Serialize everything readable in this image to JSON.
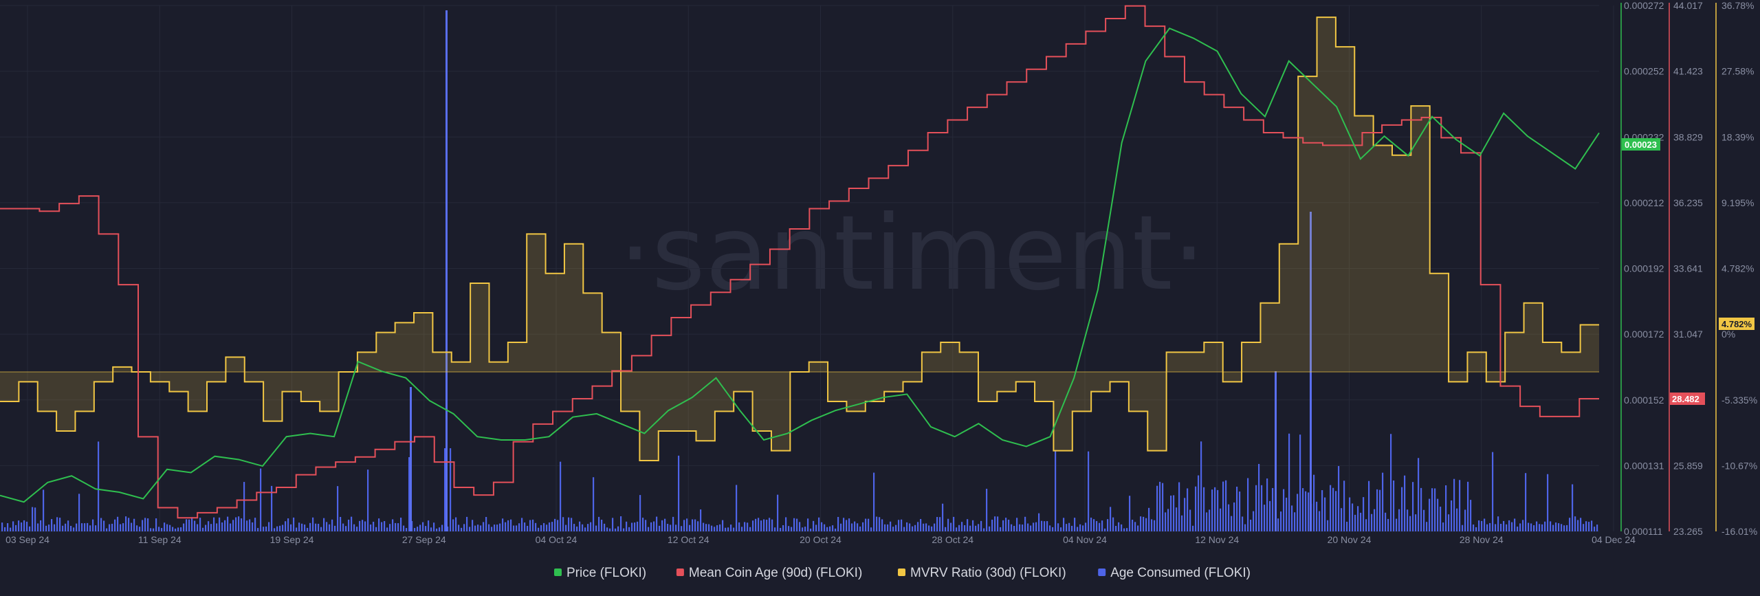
{
  "watermark": "·santiment·",
  "badges": {
    "price": "0.00023",
    "coin_age": "28.482",
    "mvrv": "4.782%"
  },
  "colors": {
    "background": "#1b1d2b",
    "price": "#2fbf4f",
    "coin_age": "#e5505a",
    "mvrv": "#f1c644",
    "age_consumed": "#4e64e8"
  },
  "chart_data": {
    "type": "line",
    "x_ticks": [
      "03 Sep 24",
      "11 Sep 24",
      "19 Sep 24",
      "27 Sep 24",
      "04 Oct 24",
      "12 Oct 24",
      "20 Oct 24",
      "28 Oct 24",
      "04 Nov 24",
      "12 Nov 24",
      "20 Nov 24",
      "28 Nov 24",
      "04 Dec 24"
    ],
    "axes": {
      "price": {
        "ticks": [
          "0.000272",
          "0.000252",
          "0.000232",
          "0.000212",
          "0.000192",
          "0.000172",
          "0.000152",
          "0.000131",
          "0.000111"
        ],
        "ylim": [
          0.000111,
          0.000272
        ]
      },
      "coin_age": {
        "ticks": [
          "44.017",
          "41.423",
          "38.829",
          "36.235",
          "33.641",
          "31.047",
          "28.482",
          "25.859",
          "23.265"
        ],
        "ylim": [
          23.265,
          44.017
        ]
      },
      "mvrv": {
        "ticks": [
          "36.78%",
          "27.58%",
          "18.39%",
          "9.195%",
          "4.782%",
          "0%",
          "-5.335%",
          "-10.67%",
          "-16.01%"
        ],
        "ylim": [
          -16.01,
          36.78
        ]
      }
    },
    "series": [
      {
        "name": "Price (FLOKI)",
        "axis": "price",
        "values": [
          0.000122,
          0.00012,
          0.000126,
          0.000128,
          0.000124,
          0.000123,
          0.000121,
          0.00013,
          0.000129,
          0.000134,
          0.000133,
          0.000131,
          0.00014,
          0.000141,
          0.00014,
          0.000163,
          0.00016,
          0.000158,
          0.000151,
          0.000147,
          0.00014,
          0.000139,
          0.000139,
          0.00014,
          0.000146,
          0.000147,
          0.000144,
          0.000141,
          0.000148,
          0.000152,
          0.000158,
          0.000148,
          0.000139,
          0.000141,
          0.000145,
          0.000148,
          0.00015,
          0.000152,
          0.000153,
          0.000143,
          0.00014,
          0.000144,
          0.000139,
          0.000137,
          0.00014,
          0.000158,
          0.000185,
          0.00023,
          0.000255,
          0.000265,
          0.000262,
          0.000258,
          0.000245,
          0.000238,
          0.000255,
          0.000248,
          0.000241,
          0.000225,
          0.000232,
          0.000226,
          0.000238,
          0.000231,
          0.000226,
          0.000239,
          0.000232,
          0.000227,
          0.000222,
          0.000233
        ]
      },
      {
        "name": "Mean Coin Age (90d) (FLOKI)",
        "axis": "coin_age",
        "values": [
          36.0,
          36.0,
          35.9,
          36.2,
          36.5,
          35.0,
          33.0,
          27.0,
          24.2,
          23.8,
          24.0,
          24.2,
          24.5,
          24.8,
          25.0,
          25.5,
          25.8,
          26.0,
          26.2,
          26.5,
          26.8,
          27.0,
          26.0,
          25.0,
          24.7,
          25.2,
          26.8,
          27.5,
          28.0,
          28.5,
          29.0,
          29.6,
          30.2,
          31.0,
          31.7,
          32.2,
          32.7,
          33.2,
          33.8,
          34.4,
          35.2,
          36.0,
          36.3,
          36.8,
          37.2,
          37.7,
          38.3,
          39.0,
          39.5,
          40.0,
          40.5,
          41.0,
          41.5,
          42.0,
          42.5,
          43.0,
          43.5,
          44.0,
          43.2,
          42.0,
          41.0,
          40.5,
          40.0,
          39.5,
          39.0,
          38.8,
          38.6,
          38.5,
          38.5,
          39.0,
          39.3,
          39.5,
          39.6,
          38.8,
          38.2,
          33.0,
          29.0,
          28.2,
          27.8,
          27.8,
          28.5
        ]
      },
      {
        "name": "MVRV Ratio (30d) (FLOKI)",
        "axis": "mvrv",
        "values": [
          -3,
          -1,
          -4,
          -6,
          -4,
          -1,
          0.5,
          0,
          -1,
          -2,
          -4,
          -1,
          1.5,
          -1,
          -5,
          -2,
          -3,
          -4,
          0,
          2,
          4,
          5,
          6,
          2,
          1,
          9,
          1,
          3,
          14,
          10,
          13,
          8,
          4,
          -4,
          -9,
          -6,
          -6,
          -7,
          -4,
          -2,
          -6,
          -8,
          0,
          1,
          -3,
          -4,
          -3,
          -2,
          -1,
          2,
          3,
          2,
          -3,
          -2,
          -1,
          -3,
          -8,
          -4,
          -2,
          -1,
          -4,
          -8,
          2,
          2,
          3,
          -1,
          3,
          7,
          13,
          30,
          36,
          33,
          26,
          23,
          22,
          27,
          10,
          -1,
          2,
          -1,
          4,
          7,
          3,
          2,
          4.782
        ]
      },
      {
        "name": "Age Consumed (FLOKI)",
        "axis": "none",
        "values": []
      }
    ]
  },
  "legend": [
    {
      "label": "Price (FLOKI)",
      "color": "#2fbf4f"
    },
    {
      "label": "Mean Coin Age (90d) (FLOKI)",
      "color": "#e5505a"
    },
    {
      "label": "MVRV Ratio (30d) (FLOKI)",
      "color": "#f1c644"
    },
    {
      "label": "Age Consumed (FLOKI)",
      "color": "#4e64e8"
    }
  ]
}
